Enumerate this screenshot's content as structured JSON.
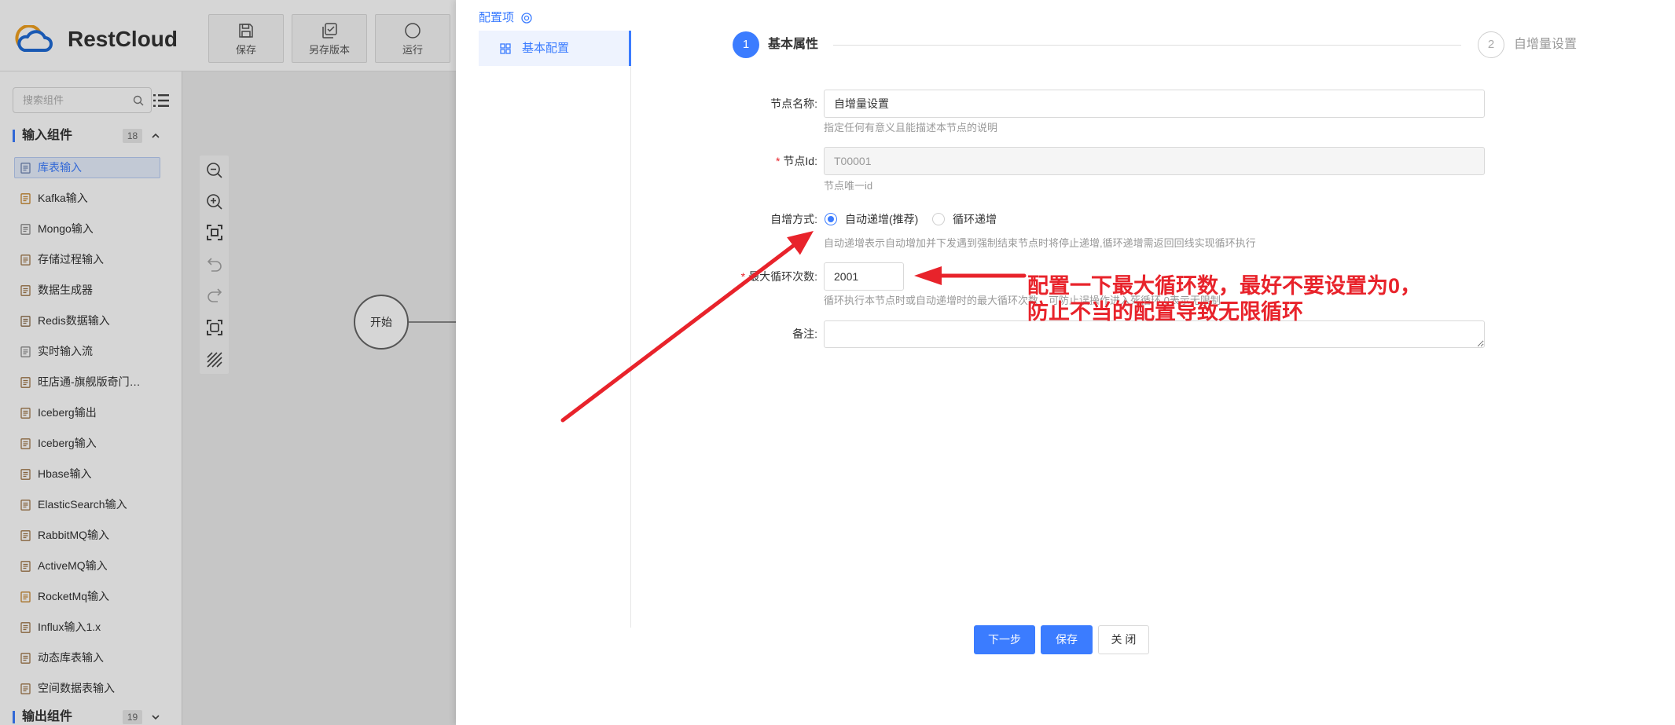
{
  "colors": {
    "primary": "#3b7cff",
    "annotation": "#e8232b",
    "mask": "rgba(0,0,0,0.16)"
  },
  "app": {
    "logo_text": "RestCloud",
    "toolbar": [
      {
        "label": "保存",
        "icon": "save-icon"
      },
      {
        "label": "另存版本",
        "icon": "save-version-icon"
      },
      {
        "label": "运行",
        "icon": "run-icon"
      }
    ]
  },
  "sidebar": {
    "search_placeholder": "搜索组件",
    "input_section": {
      "title": "输入组件",
      "count": "18",
      "expanded": true
    },
    "input_items": [
      {
        "label": "库表输入",
        "icon": "table-icon",
        "icon_color": "#6f86b3",
        "active": true
      },
      {
        "label": "Kafka输入",
        "icon": "kafka-icon",
        "icon_color": "#c8872e"
      },
      {
        "label": "Mongo输入",
        "icon": "mongo-icon",
        "icon_color": "#8c8c8c"
      },
      {
        "label": "存储过程输入",
        "icon": "procedure-icon",
        "icon_color": "#a0784a"
      },
      {
        "label": "数据生成器",
        "icon": "generator-icon",
        "icon_color": "#a0784a"
      },
      {
        "label": "Redis数据输入",
        "icon": "redis-icon",
        "icon_color": "#8c6d4a"
      },
      {
        "label": "实时输入流",
        "icon": "stream-icon",
        "icon_color": "#8c8c8c"
      },
      {
        "label": "旺店通-旗舰版奇门…",
        "icon": "doc-icon",
        "icon_color": "#a0784a"
      },
      {
        "label": "Iceberg输出",
        "icon": "iceberg-icon",
        "icon_color": "#a0784a"
      },
      {
        "label": "Iceberg输入",
        "icon": "iceberg-icon",
        "icon_color": "#a0784a"
      },
      {
        "label": "Hbase输入",
        "icon": "hbase-icon",
        "icon_color": "#a0784a"
      },
      {
        "label": "ElasticSearch输入",
        "icon": "elasticsearch-icon",
        "icon_color": "#a0784a"
      },
      {
        "label": "RabbitMQ输入",
        "icon": "rabbitmq-icon",
        "icon_color": "#a0784a"
      },
      {
        "label": "ActiveMQ输入",
        "icon": "activemq-icon",
        "icon_color": "#a0784a"
      },
      {
        "label": "RocketMq输入",
        "icon": "rocketmq-icon",
        "icon_color": "#c8872e"
      },
      {
        "label": "Influx输入1.x",
        "icon": "influx-icon",
        "icon_color": "#a0784a"
      },
      {
        "label": "动态库表输入",
        "icon": "dynamic-table-icon",
        "icon_color": "#a0784a"
      },
      {
        "label": "空间数据表输入",
        "icon": "spatial-table-icon",
        "icon_color": "#a0784a"
      }
    ],
    "output_section": {
      "title": "输出组件",
      "count": "19",
      "expanded": false
    }
  },
  "canvas": {
    "tools": [
      "zoom-out-icon",
      "zoom-in-icon",
      "fit-view-icon",
      "undo-icon",
      "redo-icon",
      "select-area-icon",
      "grid-pattern-icon"
    ],
    "start_node_label": "开始"
  },
  "drawer": {
    "nav_title": "配置项",
    "nav_items": [
      {
        "label": "基本配置",
        "active": true
      }
    ],
    "steps": [
      {
        "num": "1",
        "label": "基本属性",
        "active": true
      },
      {
        "num": "2",
        "label": "自增量设置",
        "active": false
      }
    ],
    "form": {
      "node_name": {
        "label": "节点名称:",
        "value": "自增量设置",
        "help": "指定任何有意义且能描述本节点的说明"
      },
      "node_id": {
        "required_mark": "*",
        "label": "节点Id:",
        "value": "T00001",
        "help": "节点唯一id",
        "disabled": true
      },
      "increment_mode": {
        "label": "自增方式:",
        "options": [
          {
            "label": "自动递增(推荐)",
            "checked": true
          },
          {
            "label": "循环递增",
            "checked": false
          }
        ],
        "help": "自动递增表示自动增加并下发遇到强制结束节点时将停止递增,循环递增需返回回线实现循环执行"
      },
      "max_loops": {
        "required_mark": "*",
        "label": "最大循环次数:",
        "value": "2001",
        "help": "循环执行本节点时或自动递增时的最大循环次数，可防止误操作进入死循环,0表示无限制"
      },
      "remark": {
        "label": "备注:"
      }
    },
    "buttons": {
      "next": "下一步",
      "save": "保存",
      "close": "关 闭"
    }
  },
  "annotation": {
    "line1": "配置一下最大循环数，最好不要设置为0，",
    "line2": "防止不当的配置导致无限循环"
  }
}
